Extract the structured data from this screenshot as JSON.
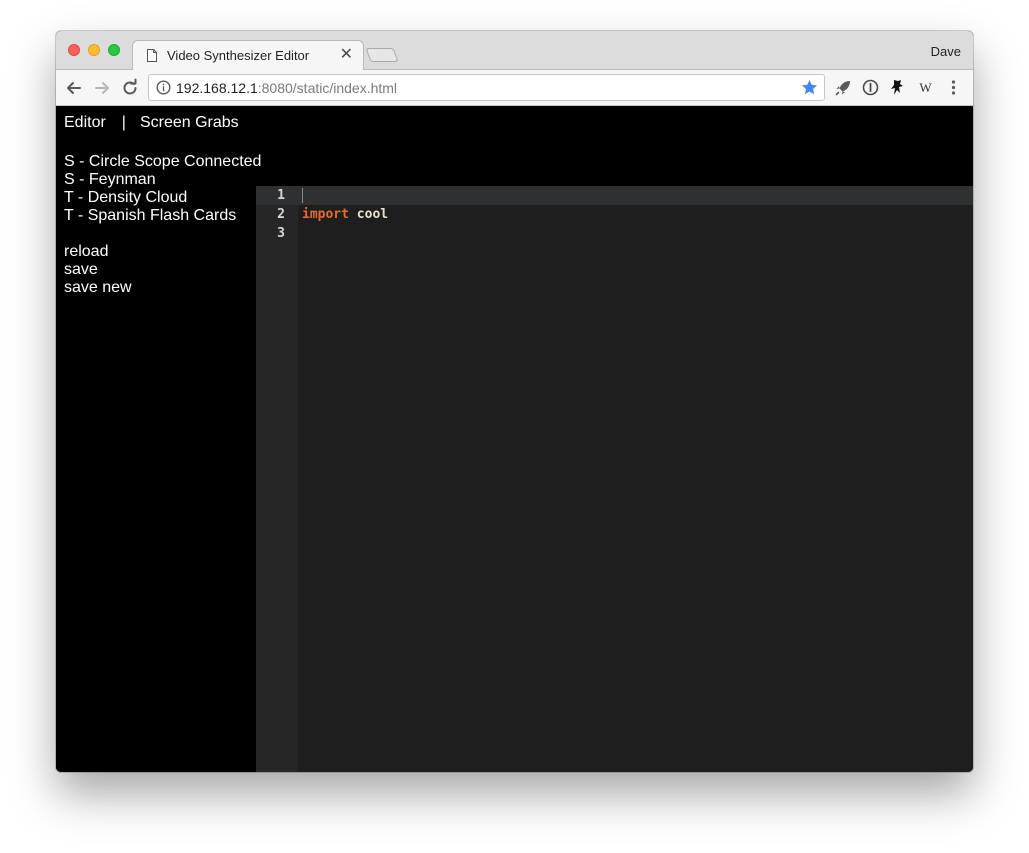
{
  "browser": {
    "tab": {
      "title": "Video Synthesizer Editor",
      "close_glyph": "✕"
    },
    "profile_name": "Dave",
    "url": {
      "host": "192.168.12.1",
      "rest": ":8080/static/index.html"
    },
    "icons": {
      "back": "back-arrow-icon",
      "forward": "forward-arrow-icon",
      "reload": "reload-icon",
      "info": "info-icon",
      "bookmark": "star-icon",
      "extensions": [
        "rocket-icon",
        "password-manager-icon",
        "ninja-icon",
        "wikipedia-icon"
      ],
      "menu": "kebab-menu-icon"
    },
    "extension_w_label": "W",
    "accent_color": "#4285f4"
  },
  "page": {
    "nav": {
      "editor": "Editor",
      "separator": "|",
      "screen_grabs": "Screen Grabs"
    },
    "programs": [
      "S - Circle Scope Connected",
      "S - Feynman",
      "T - Density Cloud",
      "T - Spanish Flash Cards"
    ],
    "actions": {
      "reload": "reload",
      "save": "save",
      "save_new": "save new"
    }
  },
  "editor": {
    "lines": [
      {
        "number": "1",
        "keyword": "",
        "rest": ""
      },
      {
        "number": "2",
        "keyword": "import",
        "rest": " cool"
      },
      {
        "number": "3",
        "keyword": "",
        "rest": ""
      }
    ],
    "colors": {
      "background": "#1e1e1e",
      "gutter": "#262626",
      "keyword": "#e66b2d",
      "identifier": "#e8e0c8"
    }
  }
}
